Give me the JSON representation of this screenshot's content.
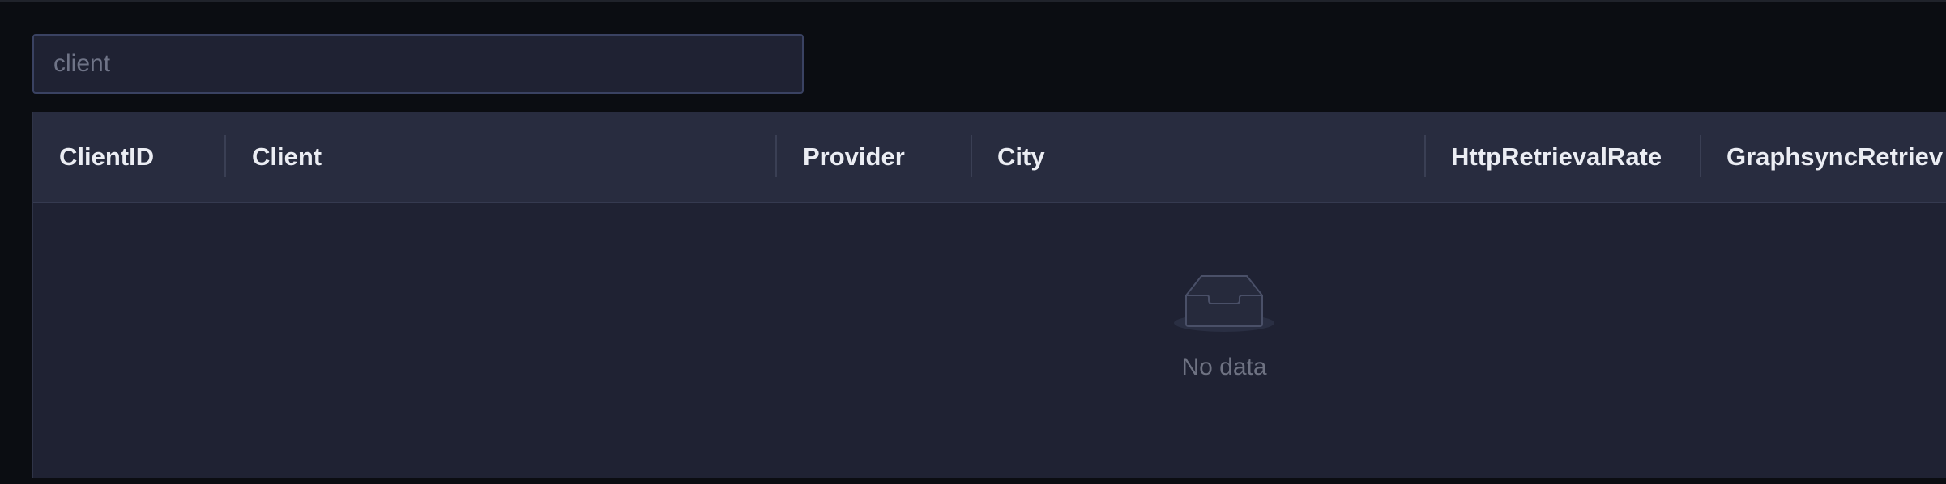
{
  "search": {
    "value": "",
    "placeholder": "client"
  },
  "table": {
    "columns": [
      "ClientID",
      "Client",
      "Provider",
      "City",
      "HttpRetrievalRate",
      "GraphsyncRetriev"
    ],
    "rows": [],
    "empty_text": "No data",
    "empty_icon": "inbox-icon"
  },
  "colors": {
    "page_background": "#0b0d12",
    "panel_background": "#1f2233",
    "header_background": "#282c3f",
    "input_border": "#3a4262",
    "header_text": "#ebedf3",
    "muted_text": "#6e7282"
  }
}
